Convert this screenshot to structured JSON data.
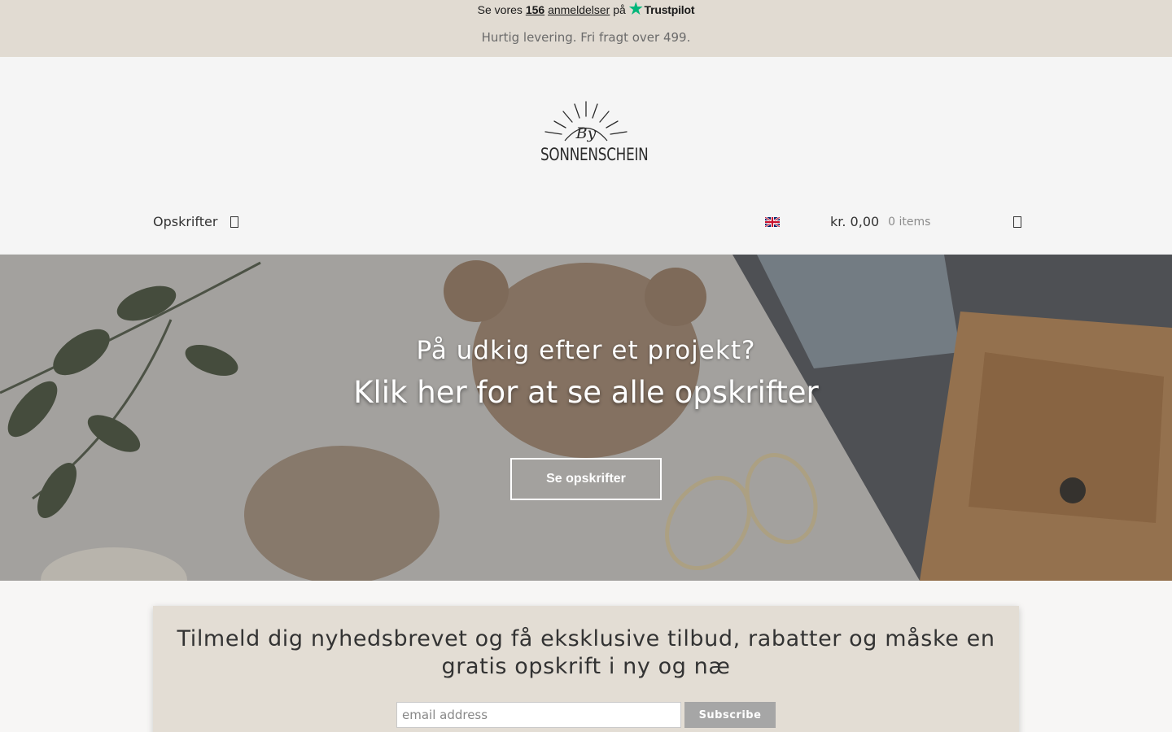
{
  "topbar": {
    "trust_prefix": "Se vores",
    "review_count": "156",
    "review_label": "anmeldelser",
    "trust_suffix": "på",
    "trustpilot_label": "Trustpilot",
    "shipping_text": "Hurtig levering. Fri fragt over 499."
  },
  "header": {
    "logo_text": "SONNENSCHEIN",
    "logo_script": "By",
    "nav_item": "Opskrifter",
    "language_icon": "uk-flag-icon",
    "cart_total": "kr. 0,00",
    "cart_items": "0 items",
    "cart_icon": "shopping-bag-icon",
    "nav_icon": "chevron-down-icon"
  },
  "hero": {
    "subtitle": "På udkig efter et projekt?",
    "title": "Klik her for at se alle opskrifter",
    "button_label": "Se opskrifter"
  },
  "newsletter": {
    "title": "Tilmeld dig nyhedsbrevet og få eksklusive tilbud, rabatter og måske en gratis opskrift i ny og næ",
    "email_placeholder": "email address",
    "subscribe_label": "Subscribe"
  },
  "colors": {
    "topbar_bg": "#e1dbd2",
    "trustpilot_green": "#00b67a",
    "newsletter_bg": "#e3ddd4",
    "subscribe_bg": "#a6a6a6"
  }
}
